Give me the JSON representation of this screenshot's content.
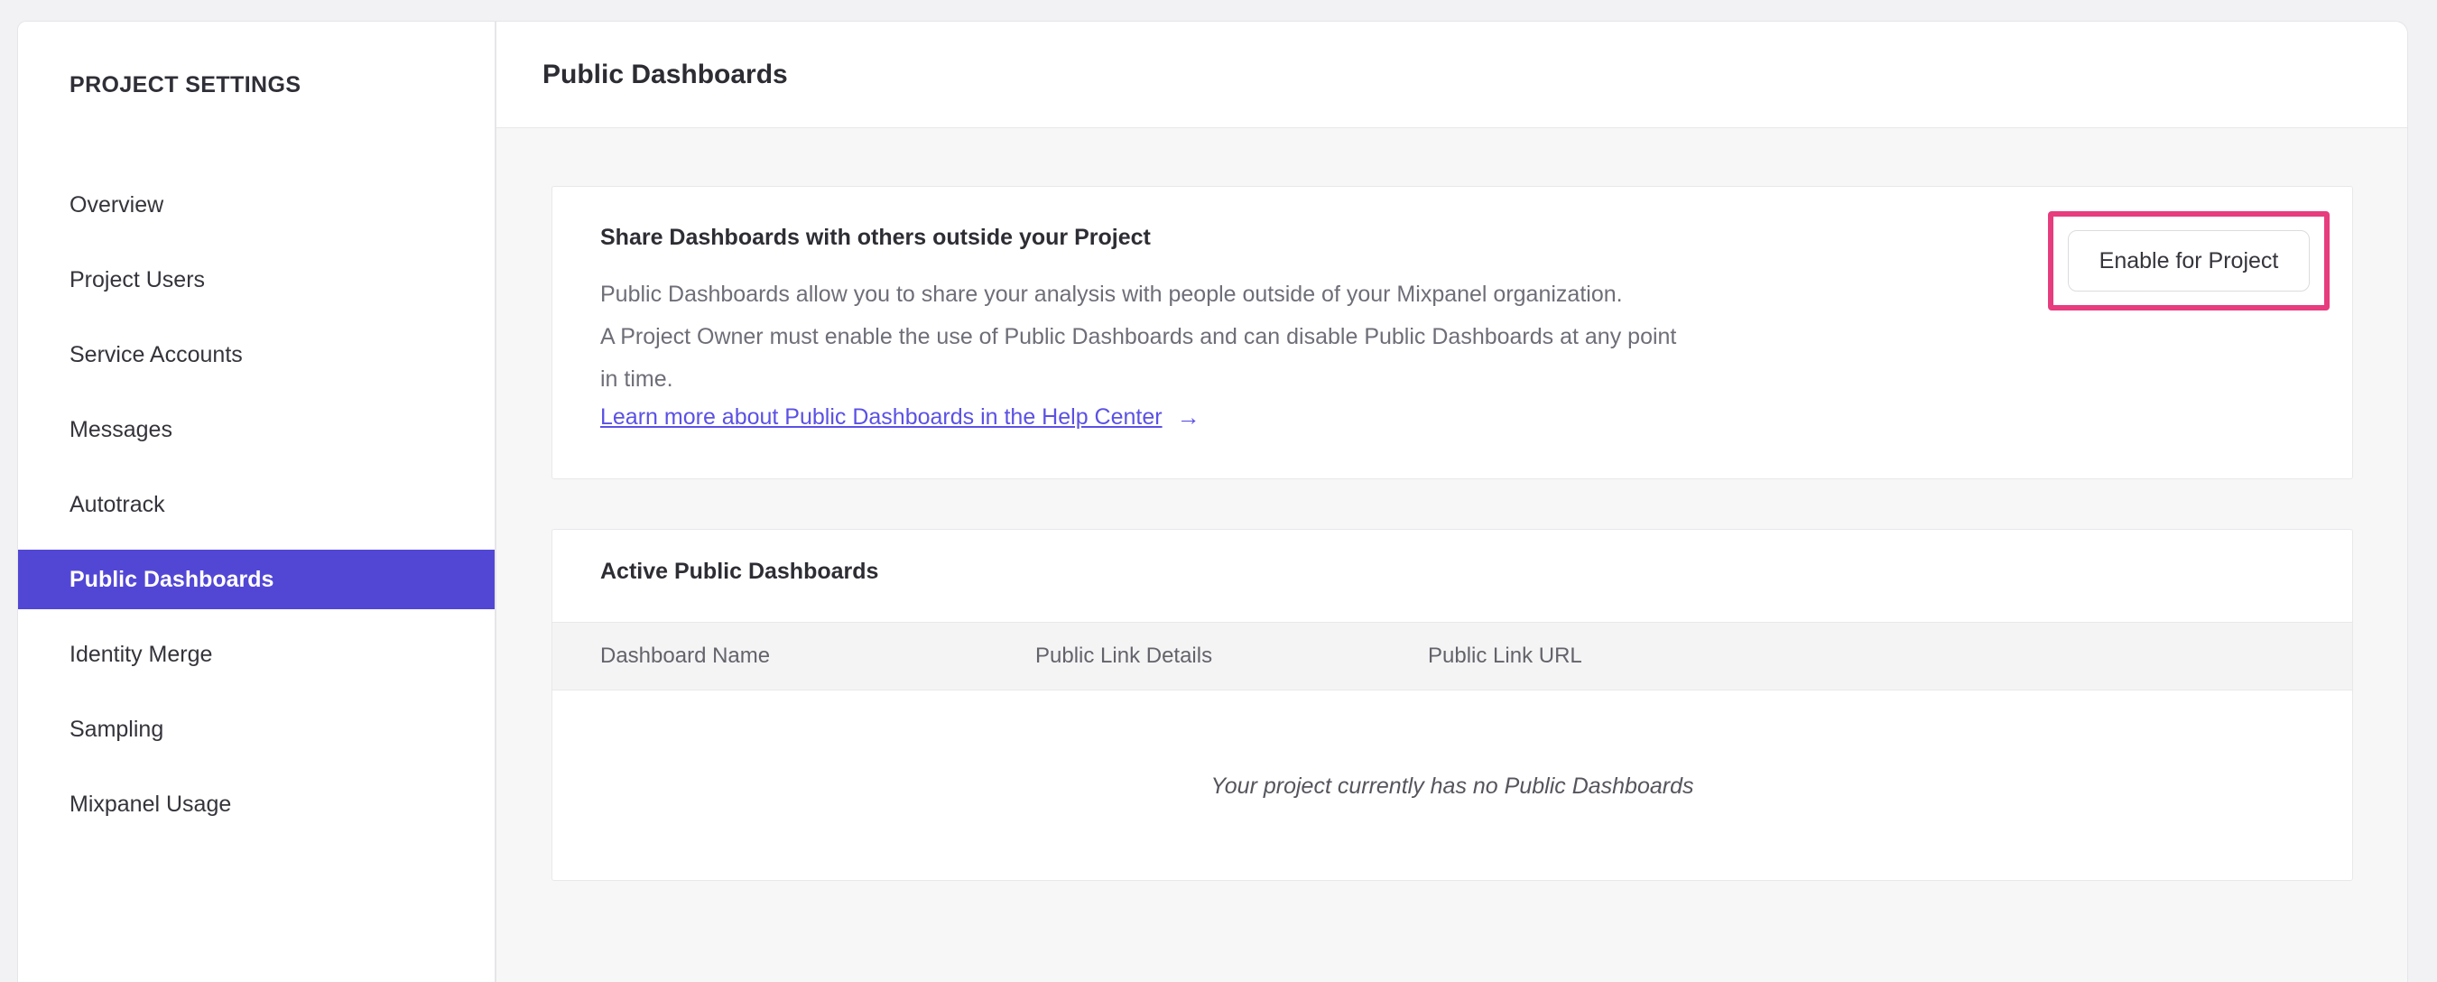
{
  "sidebar": {
    "title": "PROJECT SETTINGS",
    "items": [
      {
        "label": "Overview",
        "selected": false
      },
      {
        "label": "Project Users",
        "selected": false
      },
      {
        "label": "Service Accounts",
        "selected": false
      },
      {
        "label": "Messages",
        "selected": false
      },
      {
        "label": "Autotrack",
        "selected": false
      },
      {
        "label": "Public Dashboards",
        "selected": true
      },
      {
        "label": "Identity Merge",
        "selected": false
      },
      {
        "label": "Sampling",
        "selected": false
      },
      {
        "label": "Mixpanel Usage",
        "selected": false
      }
    ],
    "selected_color": "#5247d5"
  },
  "header": {
    "title": "Public Dashboards"
  },
  "share_card": {
    "title": "Share Dashboards with others outside your Project",
    "body_lines": [
      "Public Dashboards allow you to share your analysis with people outside of your Mixpanel organization.",
      "A Project Owner must enable the use of Public Dashboards and can disable Public Dashboards at any point",
      "in time."
    ],
    "link_label": "Learn more about Public Dashboards in the Help Center",
    "link_arrow": "→",
    "link_color": "#5b51e4",
    "button_label": "Enable for Project",
    "annotation_color": "#e73c7e"
  },
  "active_card": {
    "title": "Active Public Dashboards",
    "columns": [
      "Dashboard Name",
      "Public Link Details",
      "Public Link URL"
    ],
    "empty_message": "Your project currently has no Public Dashboards"
  }
}
